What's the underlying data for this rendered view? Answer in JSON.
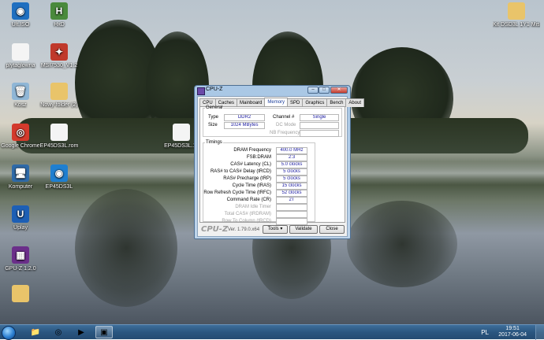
{
  "desktop": {
    "icons": [
      {
        "label": "Ult.ISO",
        "glyph": "◉",
        "color": "#1f6fc0",
        "icon": "disc-icon"
      },
      {
        "label": "HxD",
        "glyph": "H",
        "color": "#4a8a3c",
        "icon": "hex-editor-icon"
      },
      {
        "label": "plytaglowna",
        "glyph": "",
        "color": "#f4f4f4",
        "icon": "document-icon"
      },
      {
        "label": "MSI7530_V1.2",
        "glyph": "✦",
        "color": "#c0392b",
        "icon": "msi-icon"
      },
      {
        "label": "Kosz",
        "glyph": "🗑",
        "color": "#8fb6d6",
        "icon": "recycle-bin-icon"
      },
      {
        "label": "Nowy folder (2)",
        "glyph": "",
        "color": "#e9c46a",
        "icon": "folder-icon"
      },
      {
        "label": "Google Chrome",
        "glyph": "◎",
        "color": "#d33a2c",
        "icon": "chrome-icon"
      },
      {
        "label": "EP45DS3L.rom",
        "glyph": "",
        "color": "#f4f4f4",
        "icon": "file-icon"
      },
      {
        "label": "EP45DS3L.11",
        "glyph": "",
        "color": "#f4f4f4",
        "icon": "file-icon"
      },
      {
        "label": "Komputer",
        "glyph": "🖥",
        "color": "#2f6aa8",
        "icon": "computer-icon"
      },
      {
        "label": "EP45DS3L",
        "glyph": "◉",
        "color": "#1f7fd0",
        "icon": "disc-icon"
      },
      {
        "label": "Uplay",
        "glyph": "U",
        "color": "#1d5fb5",
        "icon": "uplay-icon"
      },
      {
        "label": "GPU-Z 1.2.0",
        "glyph": "▦",
        "color": "#6b2f8a",
        "icon": "gpuz-icon"
      },
      {
        "label": "",
        "glyph": "",
        "color": "#e9c46a",
        "icon": "folder-icon"
      },
      {
        "label": "Kit DSD3L 1Y1 Miscrosoft - s...",
        "glyph": "",
        "color": "#e9c46a",
        "icon": "folder-icon"
      }
    ]
  },
  "window": {
    "title": "CPU-Z",
    "tabs": [
      "CPU",
      "Caches",
      "Mainboard",
      "Memory",
      "SPD",
      "Graphics",
      "Bench",
      "About"
    ],
    "active_tab": "Memory",
    "general": {
      "legend": "General",
      "type_label": "Type",
      "type_value": "DDR2",
      "size_label": "Size",
      "size_value": "1024 MBytes",
      "channel_label": "Channel #",
      "channel_value": "Single",
      "dc_mode_label": "DC Mode",
      "dc_mode_value": "",
      "nb_freq_label": "NB Frequency",
      "nb_freq_value": ""
    },
    "timings": {
      "legend": "Timings",
      "rows": [
        {
          "label": "DRAM Frequency",
          "value": "400.0 MHz",
          "disabled": false
        },
        {
          "label": "FSB:DRAM",
          "value": "2:3",
          "disabled": false
        },
        {
          "label": "CAS# Latency (CL)",
          "value": "5.0 clocks",
          "disabled": false
        },
        {
          "label": "RAS# to CAS# Delay (tRCD)",
          "value": "5 clocks",
          "disabled": false
        },
        {
          "label": "RAS# Precharge (tRP)",
          "value": "5 clocks",
          "disabled": false
        },
        {
          "label": "Cycle Time (tRAS)",
          "value": "15 clocks",
          "disabled": false
        },
        {
          "label": "Row Refresh Cycle Time (tRFC)",
          "value": "52 clocks",
          "disabled": false
        },
        {
          "label": "Command Rate (CR)",
          "value": "2T",
          "disabled": false
        },
        {
          "label": "DRAM Idle Timer",
          "value": "",
          "disabled": true
        },
        {
          "label": "Total CAS# (tRDRAM)",
          "value": "",
          "disabled": true
        },
        {
          "label": "Row To Column (tRCD)",
          "value": "",
          "disabled": true
        }
      ]
    },
    "footer": {
      "brand": "CPU-Z",
      "version": "Ver. 1.79.0.x64",
      "tools": "Tools",
      "validate": "Validate",
      "close": "Close"
    }
  },
  "taskbar": {
    "apps": [
      {
        "icon": "explorer-icon",
        "glyph": "📁"
      },
      {
        "icon": "chrome-icon",
        "glyph": "◎"
      },
      {
        "icon": "media-player-icon",
        "glyph": "▶"
      },
      {
        "icon": "cpuz-taskbar-icon",
        "glyph": "▣"
      }
    ],
    "tray_lang": "PL",
    "time": "19:51",
    "date": "2017-06-04"
  }
}
